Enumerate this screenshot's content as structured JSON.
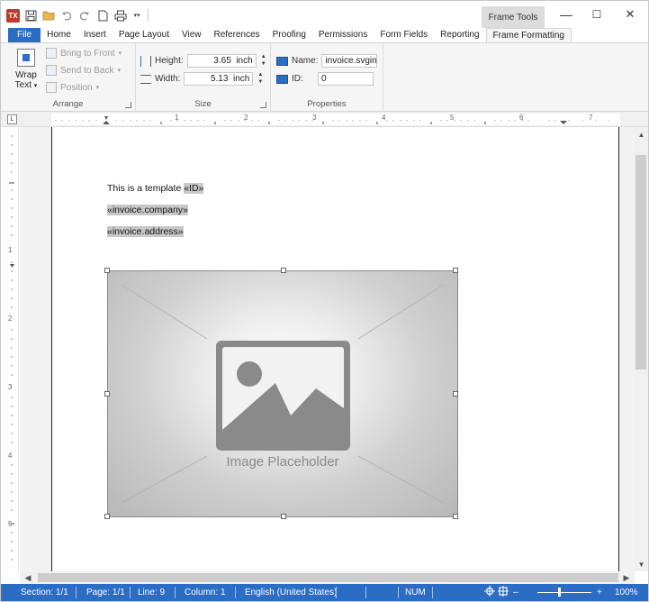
{
  "colors": {
    "accent": "#2b6cc4",
    "ribbon_bg": "#f5f5f5",
    "status_bar": "#2b6cc4"
  },
  "titlebar": {
    "app_icon_text": "TX",
    "context_tab_group": "Frame Tools",
    "quick_access_icons": [
      "save-icon",
      "open-folder-icon",
      "undo-icon",
      "redo-icon",
      "new-document-icon",
      "print-icon",
      "customize-dropdown-icon"
    ],
    "window_buttons": {
      "minimize": "—",
      "maximize": "☐",
      "close": "✕"
    }
  },
  "tabs": [
    {
      "label": "File"
    },
    {
      "label": "Home"
    },
    {
      "label": "Insert"
    },
    {
      "label": "Page Layout"
    },
    {
      "label": "View"
    },
    {
      "label": "References"
    },
    {
      "label": "Proofing"
    },
    {
      "label": "Permissions"
    },
    {
      "label": "Form Fields"
    },
    {
      "label": "Reporting"
    },
    {
      "label": "Frame Formatting"
    }
  ],
  "active_tab": "Frame Formatting",
  "ribbon": {
    "arrange": {
      "label": "Arrange",
      "wrap_text_line1": "Wrap",
      "wrap_text_line2": "Text",
      "bring_to_front": "Bring to Front",
      "send_to_back": "Send to Back",
      "position": "Position"
    },
    "size": {
      "label": "Size",
      "height_label": "Height:",
      "height_value": "3.65",
      "height_unit": "inch",
      "width_label": "Width:",
      "width_value": "5.13",
      "width_unit": "inch"
    },
    "properties": {
      "label": "Properties",
      "name_label": "Name:",
      "name_value": "invoice.svgim",
      "id_label": "ID:",
      "id_value": "0"
    }
  },
  "ruler": {
    "horizontal_numbers": [
      "1",
      "2",
      "3",
      "4",
      "5",
      "6",
      "7"
    ],
    "vertical_numbers": [
      "1",
      "2",
      "3",
      "4",
      "5"
    ]
  },
  "document": {
    "line1_text": "This is a template ",
    "line1_field": "«ID»",
    "line2_field": "«invoice.company»",
    "line3_field": "«invoice.address»",
    "image_placeholder_label": "Image Placeholder"
  },
  "statusbar": {
    "section": "Section: 1/1",
    "page": "Page: 1/1",
    "line": "Line: 9",
    "column": "Column: 1",
    "language": "English (United States)",
    "num": "NUM",
    "zoom_minus": "–",
    "zoom_plus": "+",
    "zoom": "100%",
    "zoom_fraction": 0.4
  }
}
